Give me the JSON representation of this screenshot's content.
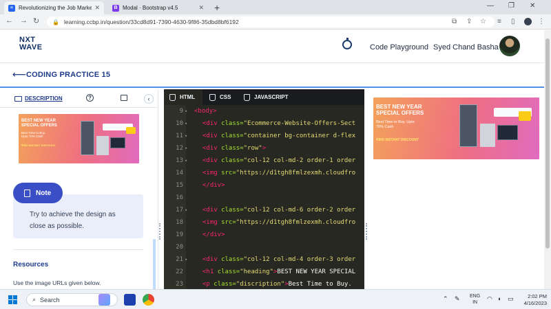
{
  "browser": {
    "tabs": [
      {
        "title": "Revolutionizing the Job Market |",
        "active": true
      },
      {
        "title": "Modal · Bootstrap v4.5",
        "active": false
      }
    ],
    "new_tab": "+",
    "url": "learning.ccbp.in/question/33cd8d91-7390-4630-9f86-35dbd8bf6192",
    "window_controls": [
      "—",
      "❐",
      "✕"
    ]
  },
  "header": {
    "logo_line1": "NXT",
    "logo_line2": "WAVE",
    "playground_label": "Code Playground",
    "user_name": "Syed Chand Basha"
  },
  "page": {
    "title": "CODING PRACTICE 15"
  },
  "left_panel": {
    "tabs": {
      "description": "DESCRIPTION"
    },
    "banner": {
      "heading": "BEST NEW YEAR SPECIAL OFFERS",
      "subtitle": "Best Time to Buy. Upto 70% Cash",
      "discount": "₹800 INSTANT DISCOUNT"
    },
    "note": {
      "label": "Note",
      "text": "Try to achieve the design as close as possible."
    },
    "resources": {
      "title": "Resources",
      "text": "Use the image URLs given below."
    }
  },
  "editor": {
    "tabs": [
      "HTML",
      "CSS",
      "JAVASCRIPT"
    ],
    "lines": [
      {
        "n": "9",
        "fold": "▾",
        "parts": [
          [
            "t",
            "<body>"
          ]
        ]
      },
      {
        "n": "10",
        "fold": "▾",
        "parts": [
          [
            "t",
            "<div "
          ],
          [
            "a",
            "class="
          ],
          [
            "s",
            "\"Ecommerce-Website-Offers-Sect"
          ]
        ]
      },
      {
        "n": "11",
        "fold": "▾",
        "parts": [
          [
            "t",
            "<div "
          ],
          [
            "a",
            "class="
          ],
          [
            "s",
            "\"container bg-container d-flex"
          ]
        ]
      },
      {
        "n": "12",
        "fold": "▾",
        "parts": [
          [
            "t",
            "<div "
          ],
          [
            "a",
            "class="
          ],
          [
            "s",
            "\"row\""
          ],
          [
            "t",
            ">"
          ]
        ]
      },
      {
        "n": "13",
        "fold": "▾",
        "parts": [
          [
            "t",
            "<div "
          ],
          [
            "a",
            "class="
          ],
          [
            "s",
            "\"col-12 col-md-2 order-1 order"
          ]
        ]
      },
      {
        "n": "14",
        "fold": "",
        "parts": [
          [
            "t",
            "<img "
          ],
          [
            "a",
            "src="
          ],
          [
            "s",
            "\"https://d1tgh8fmlzexmh.cloudfro"
          ]
        ]
      },
      {
        "n": "15",
        "fold": "",
        "parts": [
          [
            "t",
            "</div>"
          ]
        ]
      },
      {
        "n": "16",
        "fold": "",
        "parts": []
      },
      {
        "n": "17",
        "fold": "▾",
        "parts": [
          [
            "t",
            "<div "
          ],
          [
            "a",
            "class="
          ],
          [
            "s",
            "\"col-12 col-md-6 order-2 order"
          ]
        ]
      },
      {
        "n": "18",
        "fold": "",
        "parts": [
          [
            "t",
            "<img "
          ],
          [
            "a",
            "src="
          ],
          [
            "s",
            "\"https://d1tgh8fmlzexmh.cloudfro"
          ]
        ]
      },
      {
        "n": "19",
        "fold": "",
        "parts": [
          [
            "t",
            "</div>"
          ]
        ]
      },
      {
        "n": "20",
        "fold": "",
        "parts": []
      },
      {
        "n": "21",
        "fold": "▾",
        "parts": [
          [
            "t",
            "<div "
          ],
          [
            "a",
            "class="
          ],
          [
            "s",
            "\"col-12 col-md-4 order-3 order"
          ]
        ]
      },
      {
        "n": "22",
        "fold": "",
        "parts": [
          [
            "t",
            "<h1 "
          ],
          [
            "a",
            "class="
          ],
          [
            "s",
            "\"heading\""
          ],
          [
            "t",
            ">"
          ],
          [
            "x",
            "BEST NEW YEAR SPECIAL"
          ]
        ]
      },
      {
        "n": "23",
        "fold": "",
        "parts": [
          [
            "t",
            "<p "
          ],
          [
            "a",
            "class="
          ],
          [
            "s",
            "\"discription\""
          ],
          [
            "t",
            ">"
          ],
          [
            "x",
            "Best Time to Buy."
          ]
        ]
      }
    ]
  },
  "preview": {
    "banner": {
      "heading": "BEST NEW YEAR SPECIAL OFFERS",
      "subtitle": "Best Time to Buy. Upto 70% Cash",
      "discount": "₹800 INSTANT DISCOUNT"
    }
  },
  "taskbar": {
    "search_label": "Search",
    "language_line1": "ENG",
    "language_line2": "IN",
    "time": "2:02 PM",
    "date": "4/16/2023"
  },
  "colors": {
    "accent": "#1e3a8a",
    "note_pill": "#3a4fc6",
    "editor_bg": "#272822",
    "tag": "#f92672",
    "attr": "#a6e22e",
    "string": "#e6db74"
  }
}
